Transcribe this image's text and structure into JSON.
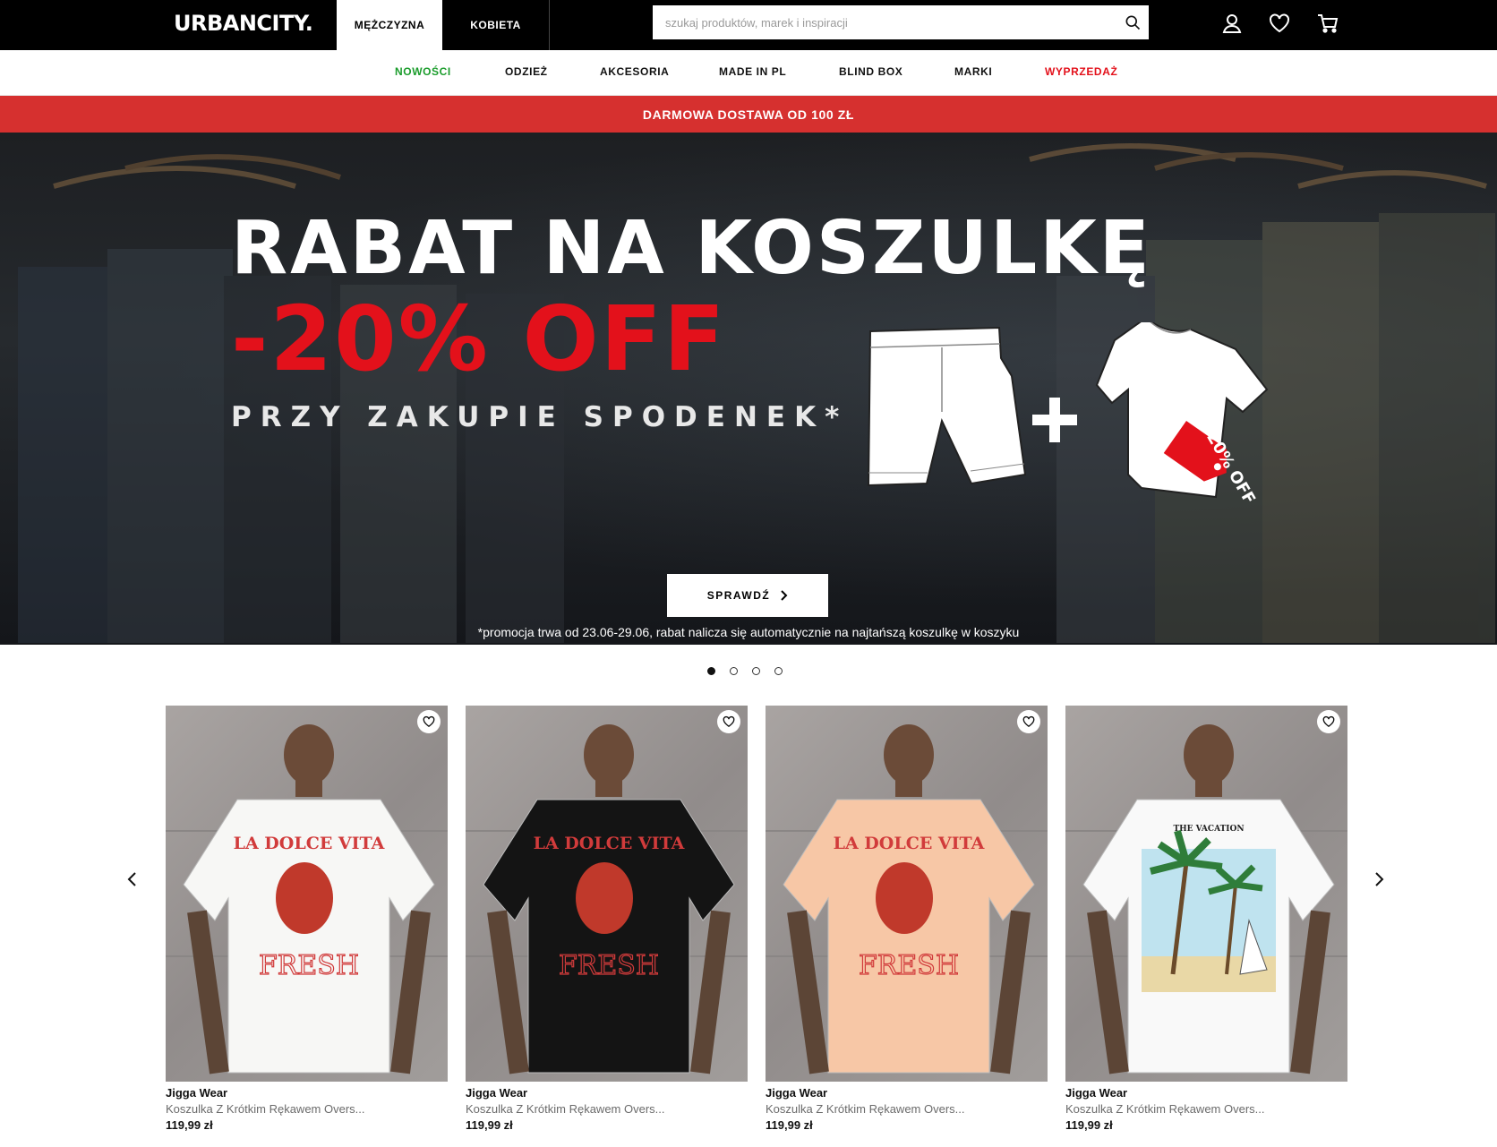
{
  "header": {
    "logo": "URBANCITY.",
    "gender_tabs": [
      {
        "label": "MĘŻCZYZNA",
        "active": true
      },
      {
        "label": "KOBIETA",
        "active": false
      }
    ],
    "search_placeholder": "szukaj produktów, marek i inspiracji",
    "icons": [
      "search-icon",
      "account-icon",
      "heart-icon",
      "cart-icon"
    ]
  },
  "nav": {
    "items": [
      {
        "label": "NOWOŚCI",
        "color": "#1a9c2b"
      },
      {
        "label": "ODZIEŻ",
        "color": "#111111"
      },
      {
        "label": "AKCESORIA",
        "color": "#111111"
      },
      {
        "label": "MADE IN PL",
        "color": "#111111"
      },
      {
        "label": "BLIND BOX",
        "color": "#111111"
      },
      {
        "label": "MARKI",
        "color": "#111111"
      },
      {
        "label": "WYPRZEDAŻ",
        "color": "#e3111b"
      }
    ]
  },
  "promo_strip": "DARMOWA DOSTAWA OD 100 ZŁ",
  "hero": {
    "title": "RABAT NA KOSZULKĘ",
    "discount": "-20% OFF",
    "subtitle": "PRZY ZAKUPIE SPODENEK*",
    "tag_text": "20% OFF",
    "button_label": "SPRAWDŹ",
    "note": "*promocja trwa od 23.06-29.06, rabat nalicza się automatycznie na najtańszą koszulkę w koszyku",
    "slides_total": 4,
    "active_slide": 1
  },
  "products": [
    {
      "brand": "Jigga Wear",
      "name": "Koszulka Z Krótkim Rękawem Overs...",
      "price": "119,99 zł",
      "shirt_color": "#f7f7f5",
      "print": "LA DOLCE VITA",
      "print_sub": "FRESH"
    },
    {
      "brand": "Jigga Wear",
      "name": "Koszulka Z Krótkim Rękawem Overs...",
      "price": "119,99 zł",
      "shirt_color": "#141414",
      "print": "LA DOLCE VITA",
      "print_sub": "FRESH"
    },
    {
      "brand": "Jigga Wear",
      "name": "Koszulka Z Krótkim Rękawem Overs...",
      "price": "119,99 zł",
      "shirt_color": "#f7c7a6",
      "print": "LA DOLCE VITA",
      "print_sub": "FRESH"
    },
    {
      "brand": "Jigga Wear",
      "name": "Koszulka Z Krótkim Rękawem Overs...",
      "price": "119,99 zł",
      "shirt_color": "#f9f9f9",
      "print": "THE VACATION",
      "print_sub": ""
    }
  ],
  "colors": {
    "brand_red": "#d6302f",
    "accent_red": "#e3111b",
    "new_green": "#1a9c2b"
  }
}
